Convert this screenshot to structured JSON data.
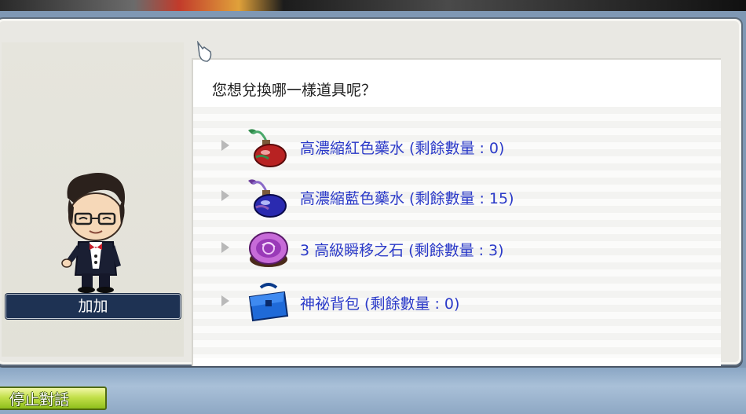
{
  "dialog": {
    "question": "您想兌換哪一樣道具呢？",
    "npc_name": "加加",
    "options": [
      {
        "icon": "red-potion-icon",
        "label": "高濃縮紅色藥水 (剩餘數量 : 0)"
      },
      {
        "icon": "blue-potion-icon",
        "label": "高濃縮藍色藥水 (剩餘數量 : 15)"
      },
      {
        "icon": "teleport-stone-icon",
        "label": "3 高級瞬移之石 (剩餘數量 : 3)"
      },
      {
        "icon": "mystery-bag-icon",
        "label": "神祕背包 (剩餘數量 : 0)"
      }
    ]
  },
  "footer": {
    "end_chat_label": "停止對話"
  },
  "colors": {
    "option_text": "#2a39c8",
    "nameplate_bg": "#1e3253",
    "end_chat_button": "#b8d83c"
  }
}
